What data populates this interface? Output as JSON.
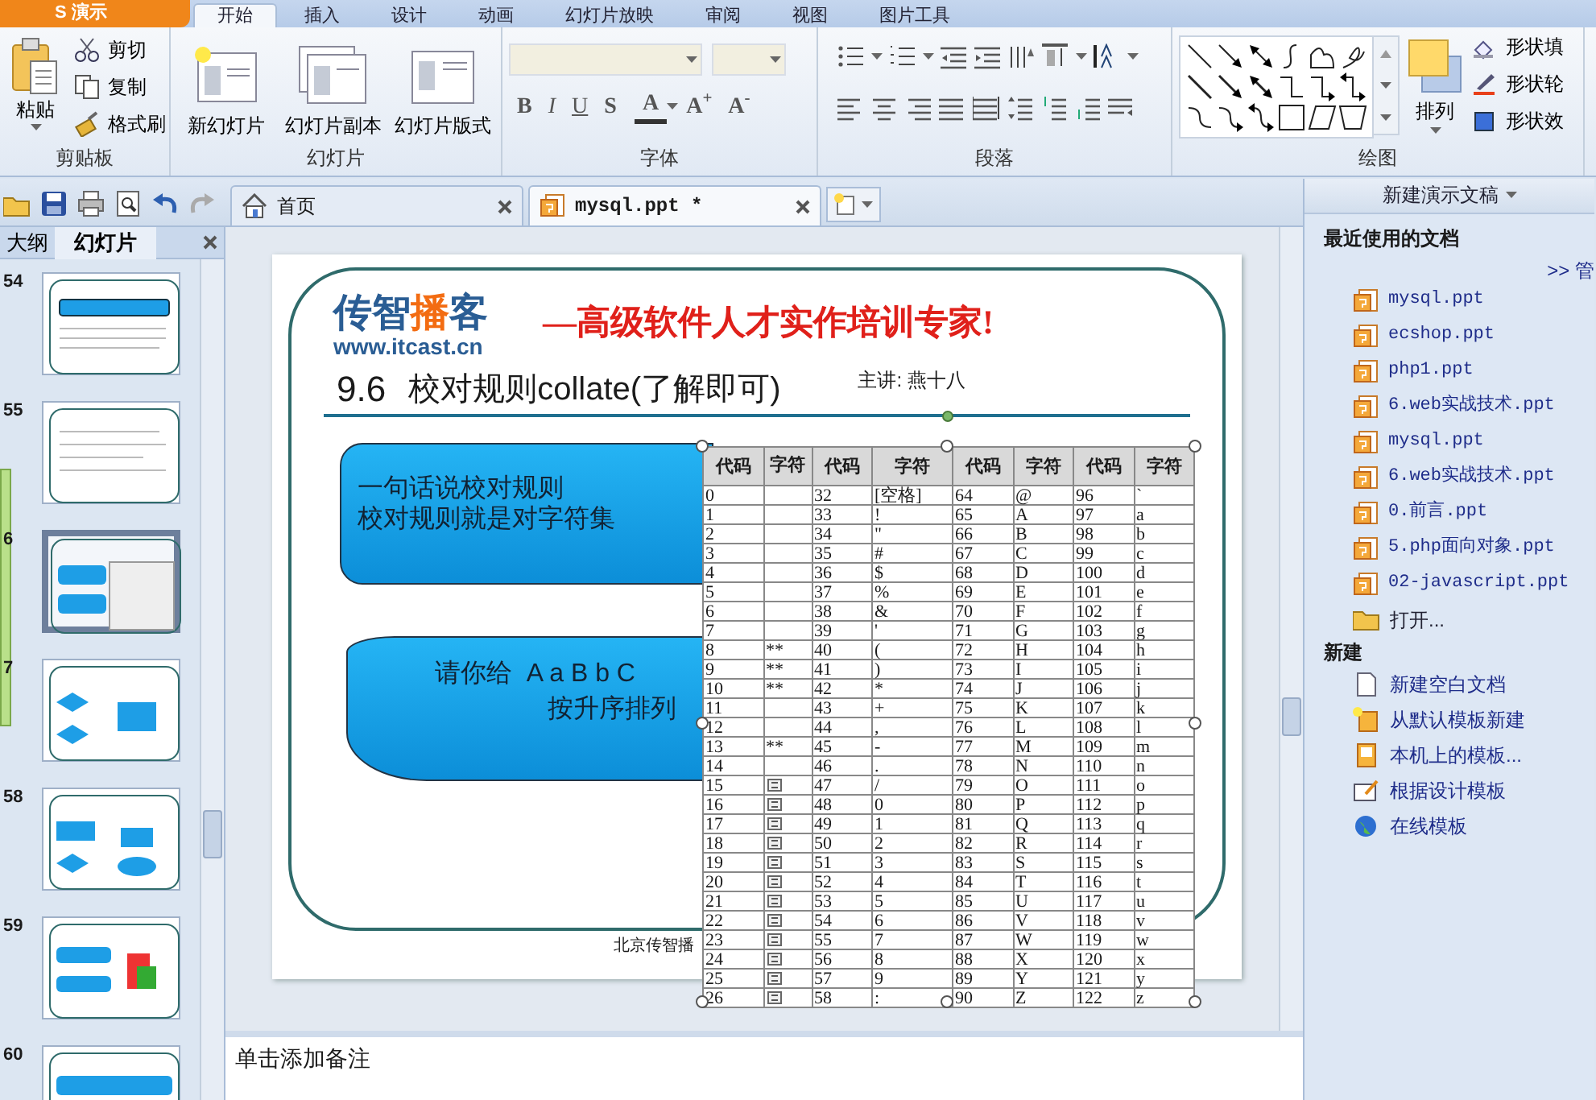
{
  "app_menu": {
    "label": "S 演示"
  },
  "ribbon_tabs": [
    {
      "label": "开始",
      "selected": true
    },
    {
      "label": "插入",
      "selected": false
    },
    {
      "label": "设计",
      "selected": false
    },
    {
      "label": "动画",
      "selected": false
    },
    {
      "label": "幻灯片放映",
      "selected": false
    },
    {
      "label": "审阅",
      "selected": false
    },
    {
      "label": "视图",
      "selected": false
    },
    {
      "label": "图片工具",
      "selected": false
    }
  ],
  "ribbon": {
    "clipboard": {
      "title": "剪贴板",
      "paste": "粘贴",
      "cut": "剪切",
      "copy": "复制",
      "format_painter": "格式刷"
    },
    "slides": {
      "title": "幻灯片",
      "buttons": [
        "新幻灯片",
        "幻灯片副本",
        "幻灯片版式"
      ]
    },
    "font": {
      "title": "字体",
      "styles": [
        "B",
        "I",
        "U",
        "S"
      ],
      "color_button": "A",
      "sizes": [
        "A$^{+}$",
        "A$^{-}$"
      ]
    },
    "paragraph": {
      "title": "段落"
    },
    "drawing": {
      "title": "绘图",
      "arrange": "排列",
      "shape_buttons": [
        "形状填",
        "形状轮",
        "形状效"
      ]
    }
  },
  "doc_tabs": [
    {
      "label": "首页",
      "selected": false,
      "kind": "home"
    },
    {
      "label": "mysql.ppt *",
      "selected": true,
      "kind": "ppt"
    }
  ],
  "panel_tabs": [
    {
      "label": "大纲",
      "selected": false
    },
    {
      "label": "幻灯片",
      "selected": true
    }
  ],
  "thumbnails": [
    {
      "number": "54",
      "selected": false
    },
    {
      "number": "55",
      "selected": false
    },
    {
      "number": "6",
      "selected": true
    },
    {
      "number": "7",
      "selected": false
    },
    {
      "number": "58",
      "selected": false
    },
    {
      "number": "59",
      "selected": false
    },
    {
      "number": "60",
      "selected": false
    }
  ],
  "slide": {
    "logo": {
      "brand_start": "传智",
      "brand_highlight": "播",
      "brand_end": "客",
      "url": "www.itcast.cn"
    },
    "slogan": "—高级软件人才实作培训专家!",
    "number": "9.6",
    "title": "校对规则collate(了解即可)",
    "presenter": "主讲: 燕十八",
    "box_1": [
      "一句话说校对规则",
      "校对规则就是对字符集"
    ],
    "box_2": [
      "请你给  A a B b C",
      "按升序排列"
    ],
    "footer": "北京传智播",
    "table": {
      "columns": [
        "代码",
        "字符",
        "代码",
        "字符",
        "代码",
        "字符",
        "代码",
        "字符"
      ],
      "rows": [
        {
          "cells": [
            "0",
            null,
            "32",
            "[空格]",
            "64",
            "@",
            "96",
            "`"
          ],
          "symbol": false
        },
        {
          "cells": [
            "1",
            null,
            "33",
            "!",
            "65",
            "A",
            "97",
            "a"
          ],
          "symbol": false
        },
        {
          "cells": [
            "2",
            null,
            "34",
            "\"",
            "66",
            "B",
            "98",
            "b"
          ],
          "symbol": false
        },
        {
          "cells": [
            "3",
            null,
            "35",
            "#",
            "67",
            "C",
            "99",
            "c"
          ],
          "symbol": false
        },
        {
          "cells": [
            "4",
            null,
            "36",
            "$",
            "68",
            "D",
            "100",
            "d"
          ],
          "symbol": false
        },
        {
          "cells": [
            "5",
            null,
            "37",
            "%",
            "69",
            "E",
            "101",
            "e"
          ],
          "symbol": false
        },
        {
          "cells": [
            "6",
            null,
            "38",
            "&",
            "70",
            "F",
            "102",
            "f"
          ],
          "symbol": false
        },
        {
          "cells": [
            "7",
            null,
            "39",
            "'",
            "71",
            "G",
            "103",
            "g"
          ],
          "symbol": false
        },
        {
          "cells": [
            "8",
            "**",
            "40",
            "(",
            "72",
            "H",
            "104",
            "h"
          ],
          "symbol": false
        },
        {
          "cells": [
            "9",
            "**",
            "41",
            ")",
            "73",
            "I",
            "105",
            "i"
          ],
          "symbol": false
        },
        {
          "cells": [
            "10",
            "**",
            "42",
            "*",
            "74",
            "J",
            "106",
            "j"
          ],
          "symbol": false
        },
        {
          "cells": [
            "11",
            null,
            "43",
            "+",
            "75",
            "K",
            "107",
            "k"
          ],
          "symbol": false
        },
        {
          "cells": [
            "12",
            null,
            "44",
            ",",
            "76",
            "L",
            "108",
            "l"
          ],
          "symbol": false
        },
        {
          "cells": [
            "13",
            "**",
            "45",
            "-",
            "77",
            "M",
            "109",
            "m"
          ],
          "symbol": false
        },
        {
          "cells": [
            "14",
            null,
            "46",
            ".",
            "78",
            "N",
            "110",
            "n"
          ],
          "symbol": false
        },
        {
          "cells": [
            "15",
            null,
            "47",
            "/",
            "79",
            "O",
            "111",
            "o"
          ],
          "symbol": true
        },
        {
          "cells": [
            "16",
            null,
            "48",
            "0",
            "80",
            "P",
            "112",
            "p"
          ],
          "symbol": true
        },
        {
          "cells": [
            "17",
            null,
            "49",
            "1",
            "81",
            "Q",
            "113",
            "q"
          ],
          "symbol": true
        },
        {
          "cells": [
            "18",
            null,
            "50",
            "2",
            "82",
            "R",
            "114",
            "r"
          ],
          "symbol": true
        },
        {
          "cells": [
            "19",
            null,
            "51",
            "3",
            "83",
            "S",
            "115",
            "s"
          ],
          "symbol": true
        },
        {
          "cells": [
            "20",
            null,
            "52",
            "4",
            "84",
            "T",
            "116",
            "t"
          ],
          "symbol": true
        },
        {
          "cells": [
            "21",
            null,
            "53",
            "5",
            "85",
            "U",
            "117",
            "u"
          ],
          "symbol": true
        },
        {
          "cells": [
            "22",
            null,
            "54",
            "6",
            "86",
            "V",
            "118",
            "v"
          ],
          "symbol": true
        },
        {
          "cells": [
            "23",
            null,
            "55",
            "7",
            "87",
            "W",
            "119",
            "w"
          ],
          "symbol": true
        },
        {
          "cells": [
            "24",
            null,
            "56",
            "8",
            "88",
            "X",
            "120",
            "x"
          ],
          "symbol": true
        },
        {
          "cells": [
            "25",
            null,
            "57",
            "9",
            "89",
            "Y",
            "121",
            "y"
          ],
          "symbol": true
        },
        {
          "cells": [
            "26",
            null,
            "58",
            ":",
            "90",
            "Z",
            "122",
            "z"
          ],
          "symbol": true
        }
      ]
    }
  },
  "notes": {
    "placeholder": "单击添加备注"
  },
  "task_pane": {
    "title": "新建演示文稿",
    "recent_heading": "最近使用的文档",
    "manage_link": ">> 管",
    "recent_files": [
      "mysql.ppt",
      "ecshop.ppt",
      "php1.ppt",
      "6.web实战技术.ppt",
      "mysql.ppt",
      "6.web实战技术.ppt",
      "0.前言.ppt",
      "5.php面向对象.ppt",
      "02-javascript.ppt"
    ],
    "open": "打开...",
    "new_heading": "新建",
    "new_items": [
      {
        "label": "新建空白文档",
        "kind": "blank"
      },
      {
        "label": "从默认模板新建",
        "kind": "default"
      },
      {
        "label": "本机上的模板...",
        "kind": "local"
      },
      {
        "label": "根据设计模板",
        "kind": "design"
      },
      {
        "label": "在线模板",
        "kind": "online"
      }
    ]
  }
}
